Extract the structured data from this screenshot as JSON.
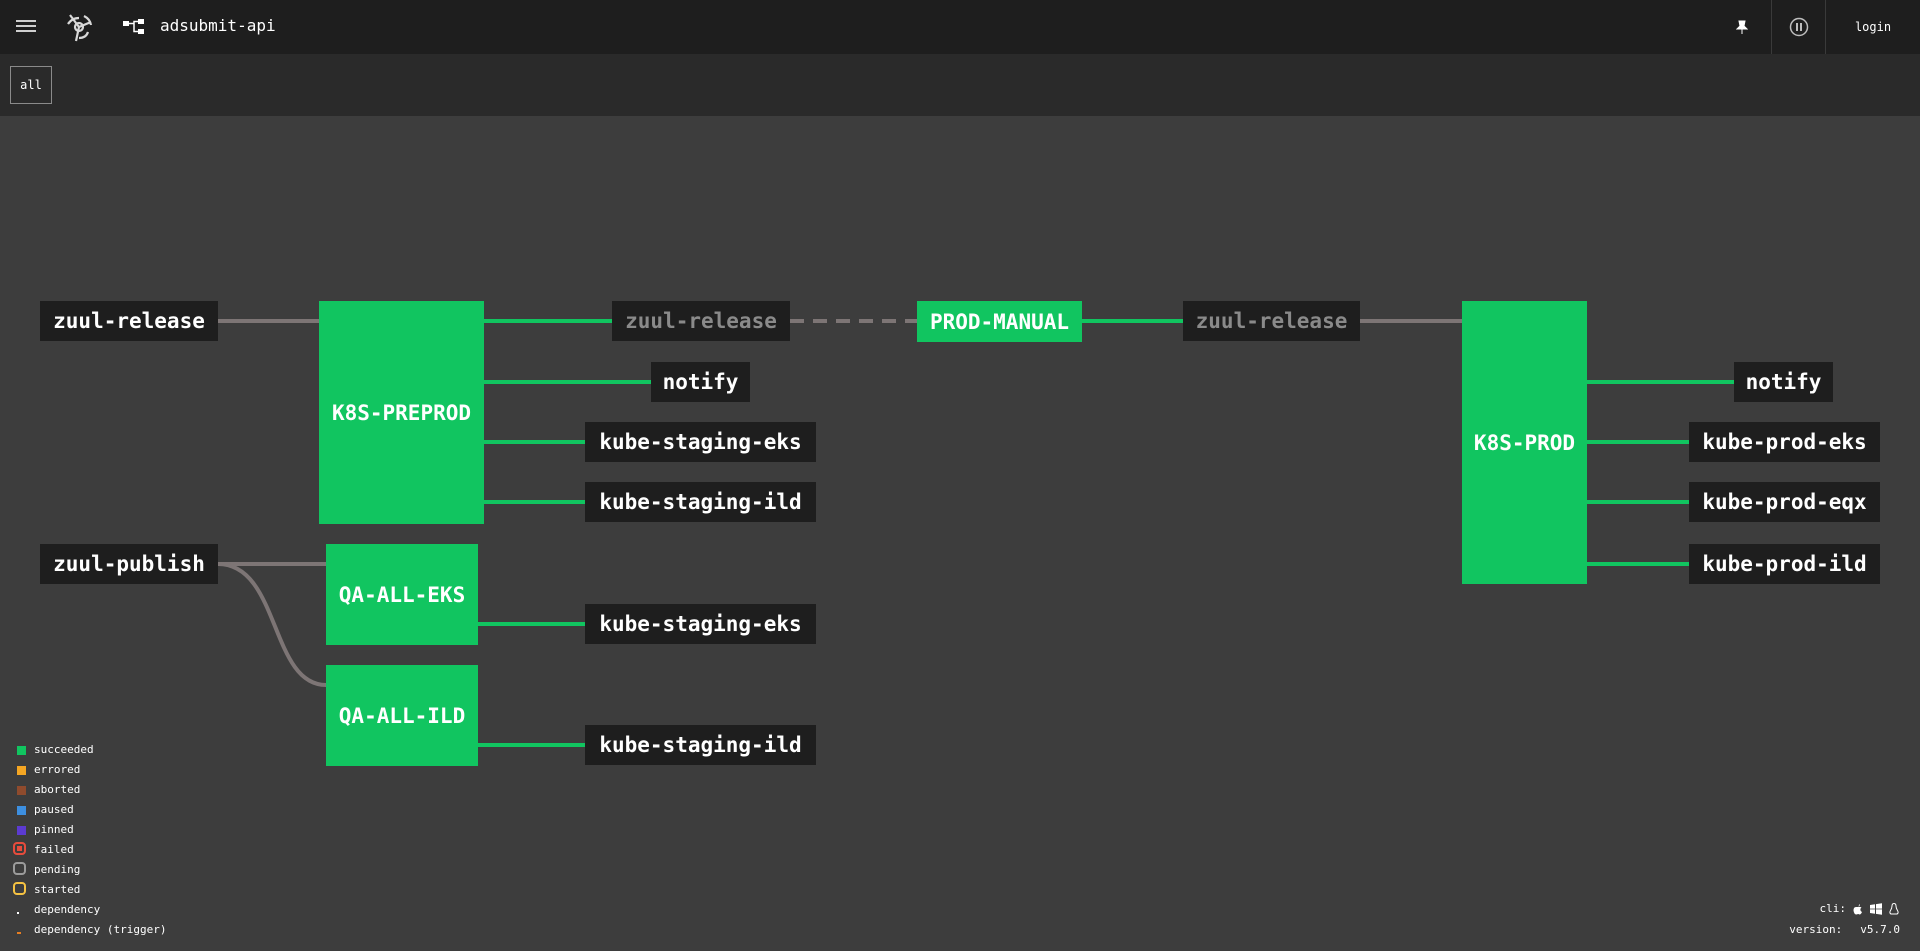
{
  "topbar": {
    "pipeline_name": "adsubmit-api",
    "login_label": "login"
  },
  "groups": [
    "all"
  ],
  "resources": {
    "zuul_release_in": "zuul-release",
    "zuul_publish": "zuul-publish",
    "zuul_release_mid": "zuul-release",
    "preprod_notify": "notify",
    "preprod_kube_eks": "kube-staging-eks",
    "preprod_kube_ild": "kube-staging-ild",
    "zuul_release_mid2": "zuul-release",
    "prod_notify": "notify",
    "prod_kube_eks": "kube-prod-eks",
    "prod_kube_eqx": "kube-prod-eqx",
    "prod_kube_ild": "kube-prod-ild",
    "qa_eks_kube": "kube-staging-eks",
    "qa_ild_kube": "kube-staging-ild"
  },
  "jobs": {
    "k8s_preprod": "K8S-PREPROD",
    "qa_all_eks": "QA-ALL-EKS",
    "qa_all_ild": "QA-ALL-ILD",
    "prod_manual": "PROD-MANUAL",
    "k8s_prod": "K8S-PROD"
  },
  "legend": [
    {
      "label": "succeeded",
      "color": "#11c560"
    },
    {
      "label": "errored",
      "color": "#f5a623"
    },
    {
      "label": "aborted",
      "color": "#8f4b2d"
    },
    {
      "label": "paused",
      "color": "#3d8fe0"
    },
    {
      "label": "pinned",
      "color": "#5c3bd1"
    },
    {
      "label": "failed",
      "color": "#e74c3c"
    },
    {
      "label": "pending",
      "color": "#9b9b9b"
    },
    {
      "label": "started",
      "color": "#f5c242"
    },
    {
      "label": "dependency",
      "color": "#ffffff"
    },
    {
      "label": "dependency (trigger)",
      "color": "#e67e22"
    }
  ],
  "footer": {
    "cli_label": "cli:",
    "version_label": "version:",
    "version_value": "v5.7.0",
    "cli_icons": [
      "apple-icon",
      "windows-icon",
      "linux-icon"
    ]
  },
  "colors": {
    "succeeded": "#11c560",
    "edge_input": "#7d7575",
    "resource_bg": "#1e1e1e",
    "background": "#3d3d3d"
  }
}
